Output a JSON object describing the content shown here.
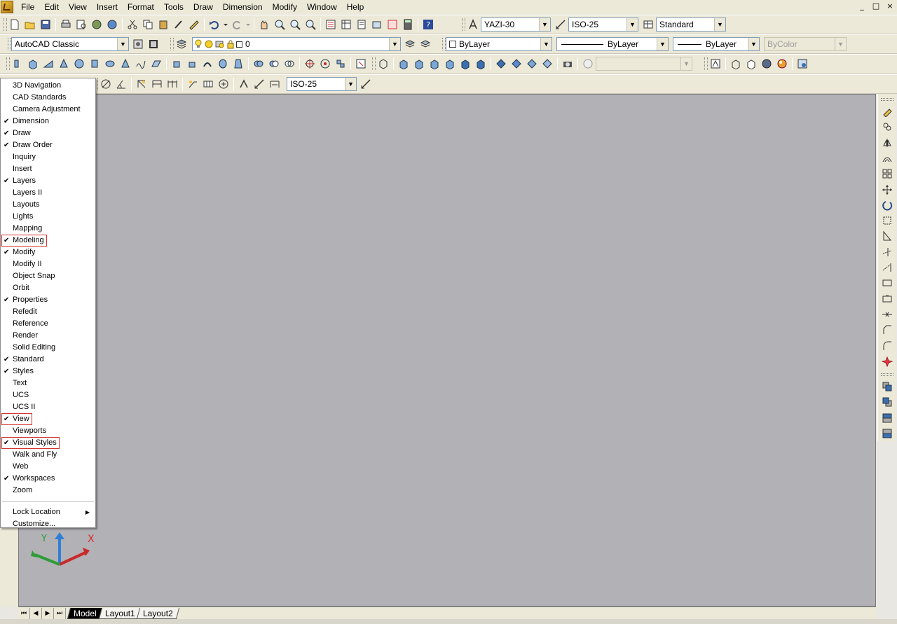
{
  "menubar": {
    "items": [
      "File",
      "Edit",
      "View",
      "Insert",
      "Format",
      "Tools",
      "Draw",
      "Dimension",
      "Modify",
      "Window",
      "Help"
    ],
    "window_controls": [
      "_",
      "□",
      "×"
    ]
  },
  "styles_toolbar": {
    "text_style": "YAZI-30",
    "dim_style": "ISO-25",
    "table_style": "Standard"
  },
  "workspace": "AutoCAD Classic",
  "layer": {
    "current": "0"
  },
  "properties": {
    "color": "ByLayer",
    "linetype": "ByLayer",
    "lineweight": "ByLayer",
    "plot_style": "ByColor"
  },
  "dim_toolbar": {
    "dim_style": "ISO-25"
  },
  "toolbar_menu": {
    "items": [
      {
        "label": "3D Navigation",
        "checked": false,
        "highlighted": false
      },
      {
        "label": "CAD Standards",
        "checked": false,
        "highlighted": false
      },
      {
        "label": "Camera Adjustment",
        "checked": false,
        "highlighted": false
      },
      {
        "label": "Dimension",
        "checked": true,
        "highlighted": false
      },
      {
        "label": "Draw",
        "checked": true,
        "highlighted": false
      },
      {
        "label": "Draw Order",
        "checked": true,
        "highlighted": false
      },
      {
        "label": "Inquiry",
        "checked": false,
        "highlighted": false
      },
      {
        "label": "Insert",
        "checked": false,
        "highlighted": false
      },
      {
        "label": "Layers",
        "checked": true,
        "highlighted": false
      },
      {
        "label": "Layers II",
        "checked": false,
        "highlighted": false
      },
      {
        "label": "Layouts",
        "checked": false,
        "highlighted": false
      },
      {
        "label": "Lights",
        "checked": false,
        "highlighted": false
      },
      {
        "label": "Mapping",
        "checked": false,
        "highlighted": false
      },
      {
        "label": "Modeling",
        "checked": true,
        "highlighted": true
      },
      {
        "label": "Modify",
        "checked": true,
        "highlighted": false
      },
      {
        "label": "Modify II",
        "checked": false,
        "highlighted": false
      },
      {
        "label": "Object Snap",
        "checked": false,
        "highlighted": false
      },
      {
        "label": "Orbit",
        "checked": false,
        "highlighted": false
      },
      {
        "label": "Properties",
        "checked": true,
        "highlighted": false
      },
      {
        "label": "Refedit",
        "checked": false,
        "highlighted": false
      },
      {
        "label": "Reference",
        "checked": false,
        "highlighted": false
      },
      {
        "label": "Render",
        "checked": false,
        "highlighted": false
      },
      {
        "label": "Solid Editing",
        "checked": false,
        "highlighted": false
      },
      {
        "label": "Standard",
        "checked": true,
        "highlighted": false
      },
      {
        "label": "Styles",
        "checked": true,
        "highlighted": false
      },
      {
        "label": "Text",
        "checked": false,
        "highlighted": false
      },
      {
        "label": "UCS",
        "checked": false,
        "highlighted": false
      },
      {
        "label": "UCS II",
        "checked": false,
        "highlighted": false
      },
      {
        "label": "View",
        "checked": true,
        "highlighted": true
      },
      {
        "label": "Viewports",
        "checked": false,
        "highlighted": false
      },
      {
        "label": "Visual Styles",
        "checked": true,
        "highlighted": true
      },
      {
        "label": "Walk and Fly",
        "checked": false,
        "highlighted": false
      },
      {
        "label": "Web",
        "checked": false,
        "highlighted": false
      },
      {
        "label": "Workspaces",
        "checked": true,
        "highlighted": false
      },
      {
        "label": "Zoom",
        "checked": false,
        "highlighted": false
      }
    ],
    "lock_location": "Lock Location",
    "customize": "Customize..."
  },
  "ucs": {
    "x_label": "X",
    "y_label": "Y"
  },
  "layout_tabs": {
    "tabs": [
      "Model",
      "Layout1",
      "Layout2"
    ],
    "active": "Model"
  },
  "colors": {
    "canvas_bg": "#b2b1b5",
    "chrome_bg": "#ece9d8",
    "highlight_box": "#d2332e"
  }
}
